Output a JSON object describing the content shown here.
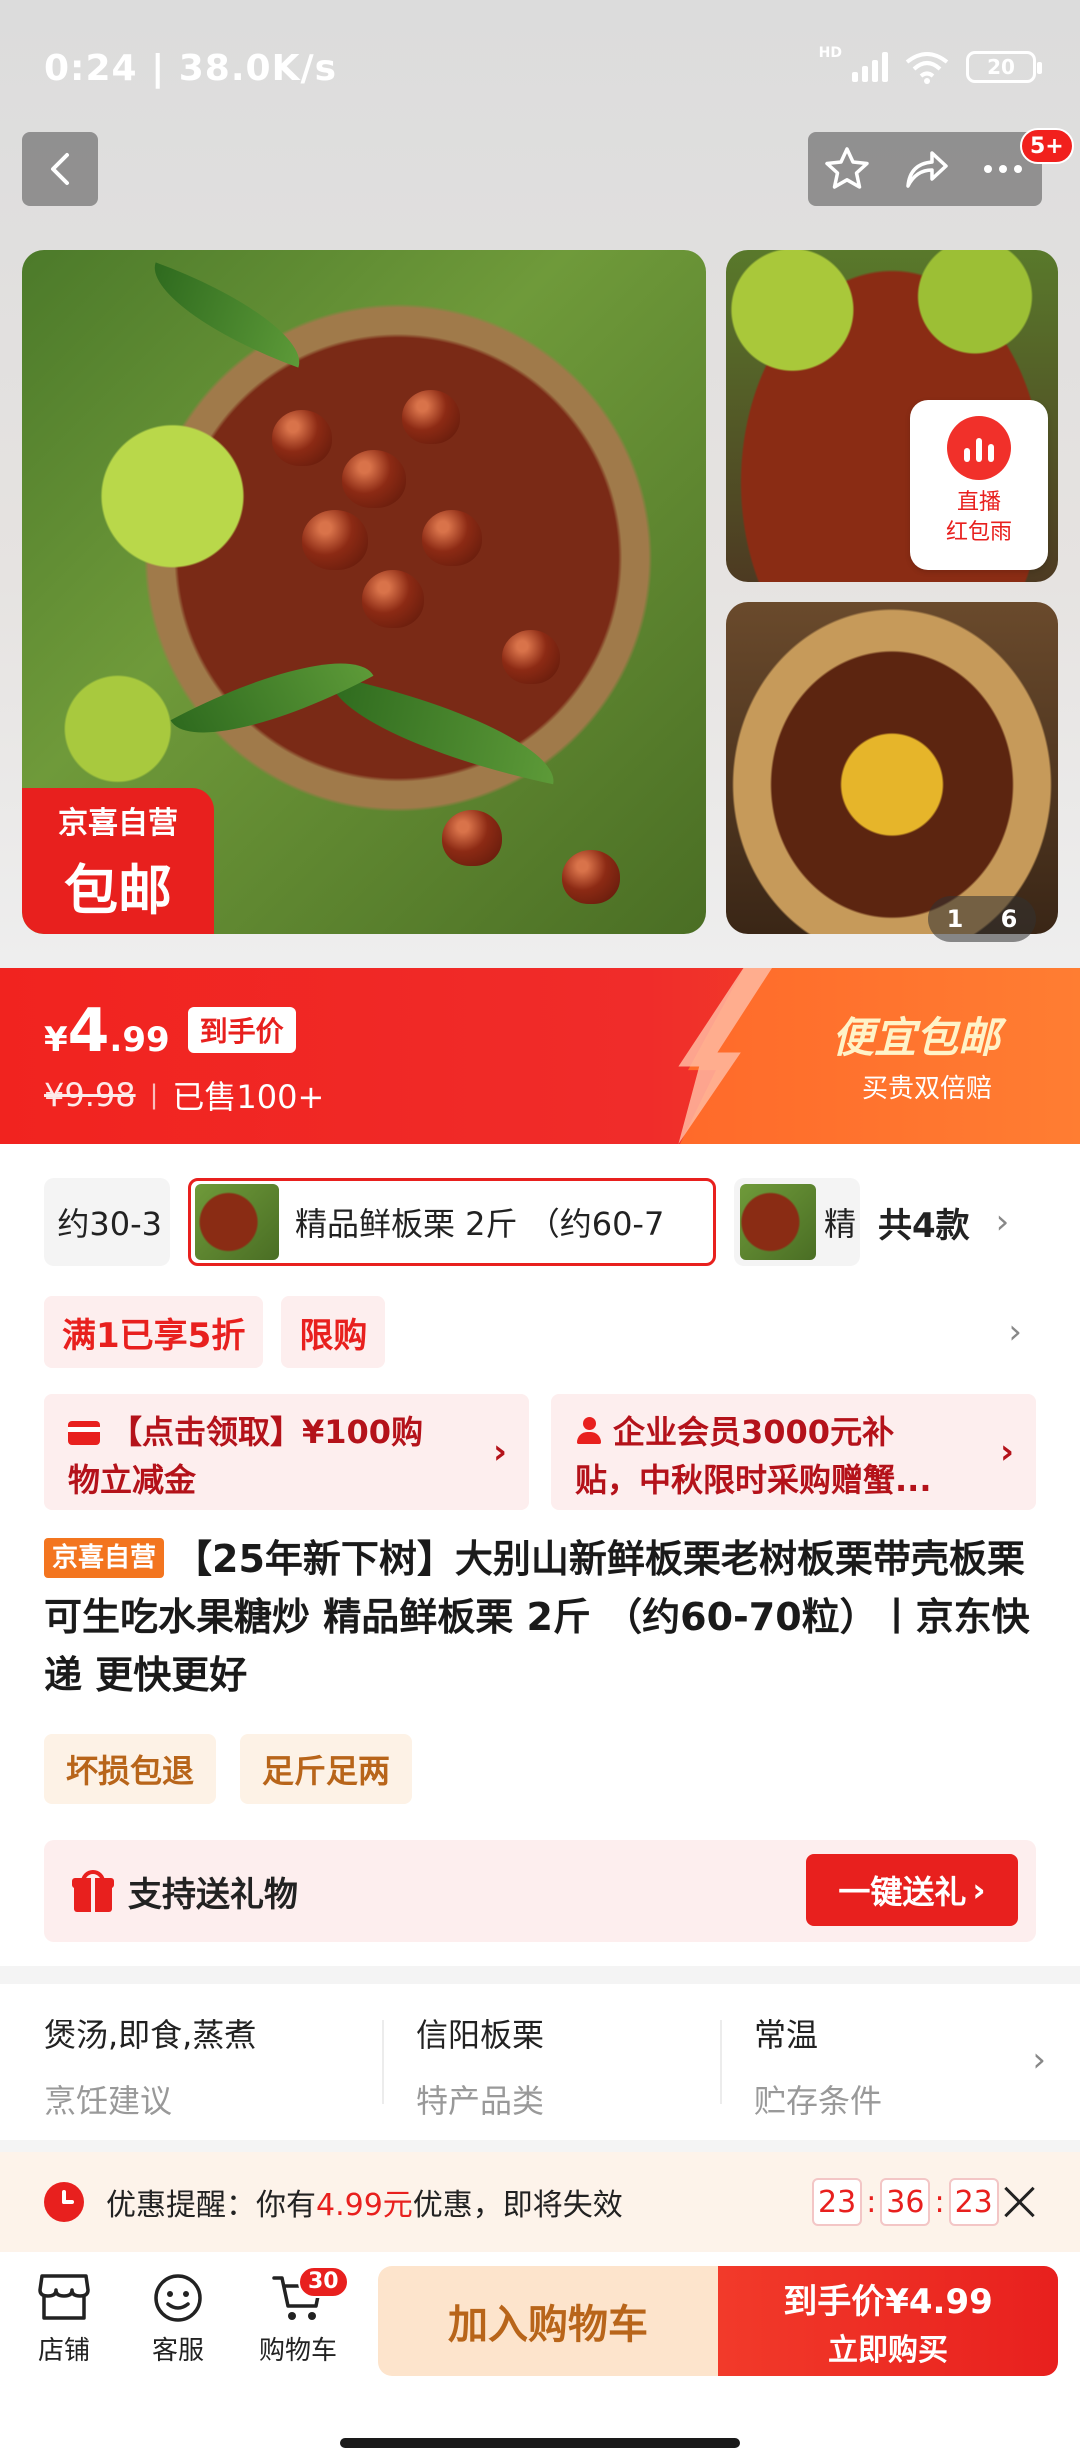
{
  "status_bar": {
    "time_speed": "0:24 | 38.0K/s",
    "network": "HD",
    "battery": "20"
  },
  "header": {
    "more_badge": "5+"
  },
  "gallery": {
    "main_tag_line1": "京喜自营",
    "main_tag_line2": "包邮",
    "live_label_line1": "直播",
    "live_label_line2": "红包雨",
    "pager_current": "1",
    "pager_total": "6"
  },
  "price": {
    "currency": "¥",
    "integer": "4",
    "decimal": ".99",
    "hand_price_label": "到手价",
    "original": "¥9.98",
    "sold": "已售100+",
    "promo_title": "便宜包邮",
    "promo_sub": "买贵双倍赔"
  },
  "variants": {
    "items": [
      "约30-3",
      "精品鲜板栗 2斤 （约60-7",
      "精"
    ],
    "all_label": "共4款"
  },
  "promo_tags": [
    "满1已享5折",
    "限购"
  ],
  "coupons": [
    {
      "line1": "【点击领取】¥100购",
      "line2": "物立减金"
    },
    {
      "line1": "企业会员3000元补",
      "line2": "贴，中秋限时采购赠蟹..."
    }
  ],
  "product": {
    "self_tag": "京喜自营",
    "title": "【25年新下树】大别山新鲜板栗老树板栗带壳板栗可生吃水果糖炒 精品鲜板栗 2斤 （约60-70粒）丨京东快递 更快更好"
  },
  "services": [
    "坏损包退",
    "足斤足两"
  ],
  "gift": {
    "label": "支持送礼物",
    "button": "一键送礼"
  },
  "attributes": [
    {
      "value": "煲汤,即食,蒸煮",
      "key": "烹饪建议"
    },
    {
      "value": "信阳板栗",
      "key": "特产品类"
    },
    {
      "value": "常温",
      "key": "贮存条件"
    }
  ],
  "reminder": {
    "prefix": "优惠提醒：你有",
    "amount": "4.99元",
    "suffix": "优惠，即将失效",
    "hh": "23",
    "mm": "36",
    "ss": "23"
  },
  "bottom_bar": {
    "shop": "店铺",
    "service": "客服",
    "cart": "购物车",
    "cart_count": "30",
    "add_to_cart": "加入购物车",
    "buy_line1": "到手价¥4.99",
    "buy_line2": "立即购买"
  },
  "colors": {
    "brand_red": "#e8201e",
    "promo_orange": "#ff7d32",
    "self_tag_orange": "#f3751f"
  }
}
